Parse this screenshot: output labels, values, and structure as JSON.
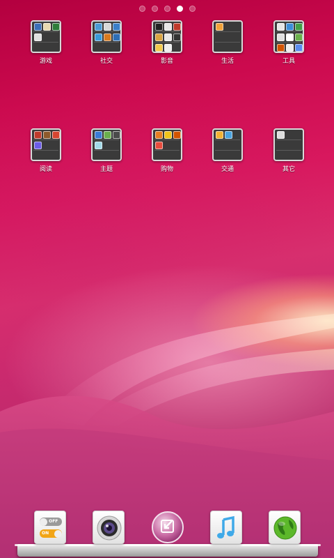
{
  "screen": {
    "page_indicator": {
      "count": 5,
      "active_index": 3
    }
  },
  "folders": [
    {
      "label": "游戏",
      "icon": "folder-games-icon",
      "mini_colors": [
        "#3c6fb8",
        "#e8d9b0",
        "#2f7d3a",
        "#e0e0e0"
      ]
    },
    {
      "label": "社交",
      "icon": "folder-social-icon",
      "mini_colors": [
        "#4a9bd6",
        "#d8d8d8",
        "#3b7fc9",
        "#3a9ad9",
        "#d97a1e",
        "#2e6eb5"
      ]
    },
    {
      "label": "影音",
      "icon": "folder-media-icon",
      "mini_colors": [
        "#222222",
        "#e8e8e8",
        "#c0392b",
        "#d9a441",
        "#e8e8e8",
        "#333333",
        "#f2c94c",
        "#eeeeee"
      ]
    },
    {
      "label": "生活",
      "icon": "folder-life-icon",
      "mini_colors": [
        "#f2a33a"
      ]
    },
    {
      "label": "工具",
      "icon": "folder-tools-icon",
      "mini_colors": [
        "#e6e6e6",
        "#3d8ed8",
        "#43a047",
        "#e0e0e0",
        "#ffffff",
        "#6ab04c",
        "#d35400",
        "#eeeeee",
        "#5b8def"
      ]
    },
    {
      "label": "阅读",
      "icon": "folder-reading-icon",
      "mini_colors": [
        "#c0392b",
        "#8e5a2b",
        "#d64531",
        "#6c5ce7"
      ]
    },
    {
      "label": "主题",
      "icon": "folder-themes-icon",
      "mini_colors": [
        "#3a7bd5",
        "#6ab04c",
        "#4a4a4a",
        "#a3d9e8"
      ]
    },
    {
      "label": "购物",
      "icon": "folder-shopping-icon",
      "mini_colors": [
        "#e67e22",
        "#f0c419",
        "#d35400",
        "#e84c3d"
      ]
    },
    {
      "label": "交通",
      "icon": "folder-transport-icon",
      "mini_colors": [
        "#f2b233",
        "#4aa3df"
      ]
    },
    {
      "label": "其它",
      "icon": "folder-other-icon",
      "mini_colors": [
        "#dddddd"
      ]
    }
  ],
  "dock": [
    {
      "name": "toggle-switch-app",
      "icon": "toggle-switch-icon",
      "off_text": "OFF",
      "on_text": "ON"
    },
    {
      "name": "camera-app",
      "icon": "camera-lens-icon"
    },
    {
      "name": "launcher-app",
      "icon": "launcher-arrow-icon"
    },
    {
      "name": "music-app",
      "icon": "music-note-icon"
    },
    {
      "name": "browser-app",
      "icon": "globe-icon"
    }
  ],
  "colors": {
    "toggle_off": "#8a8a8a",
    "toggle_on": "#f2a516",
    "music_blue": "#3fa9e8",
    "globe_green": "#5cb82a"
  }
}
